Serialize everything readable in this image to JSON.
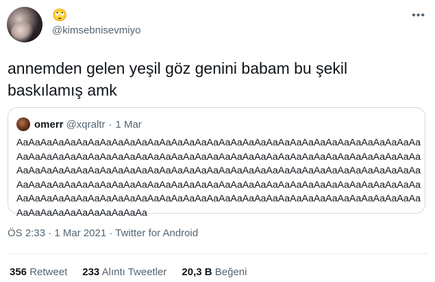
{
  "author": {
    "emoji": "🙄",
    "handle": "@kimsebnisevmiyo"
  },
  "tweet": {
    "text": "annemden gelen yeşil göz genini babam bu şekil baskılamış amk"
  },
  "quoted": {
    "name": "omerr",
    "handle": "@xqraltr",
    "separator": "·",
    "date": "1 Mar",
    "body": "AaAaAaAaAaAaAaAaAaAaAaAaAaAaAaAaAaAaAaAaAaAaAaAaAaAaAaAaAaAaAaAaAaAaAaAaAaAaAaAaAaAaAaAaAaAaAaAaAaAaAaAaAaAaAaAaAaAaAaAaAaAaAaAaAaAaAaAaAaAaAaAaAaAaAaAaAaAaAaAaAaAaAaAaAaAaAaAaAaAaAaAaAaAaAaAaAaAaAaAaAaAaAaAaAaAaAaAaAaAaAaAaAaAaAaAaAaAaAaAaAaAaAaAaAaAaAaAaAaAaAaAaAaAaAaAaAaAaAaAaAaAaAaAaAaAaAaAaAaAaAaAaAaAaAaAaAaAaAaAaAaAaAaAaAaAaAaAaAaAaAaAaAaAaAaAaAaAaAaAaAa"
  },
  "meta": {
    "timestamp": "ÖS 2:33 · 1 Mar 2021 · Twitter for Android"
  },
  "stats": {
    "retweets_count": "356",
    "retweets_label": "Retweet",
    "quotes_count": "233",
    "quotes_label": "Alıntı Tweetler",
    "likes_count": "20,3 B",
    "likes_label": "Beğeni"
  },
  "icons": {
    "more": "more-icon"
  }
}
